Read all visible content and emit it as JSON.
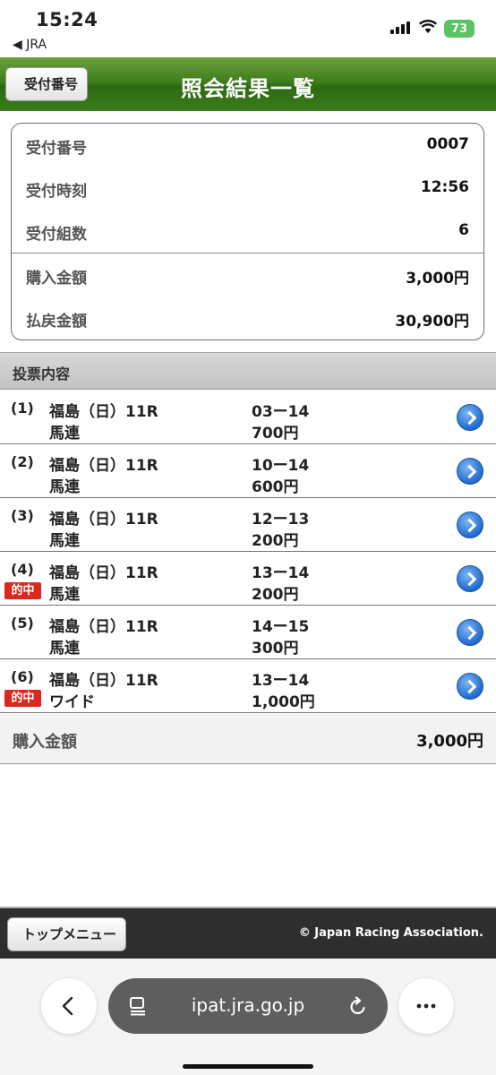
{
  "status_bar": {
    "time": "15:24",
    "back_app": "◀ JRA",
    "battery": "73"
  },
  "header": {
    "title": "照会結果一覧",
    "back_label": "受付番号"
  },
  "summary": [
    {
      "label": "受付番号",
      "value": "0007"
    },
    {
      "label": "受付時刻",
      "value": "12:56"
    },
    {
      "label": "受付組数",
      "value": "6"
    },
    {
      "label": "購入金額",
      "value": "3,000円"
    },
    {
      "label": "払戻金額",
      "value": "30,900円"
    }
  ],
  "section_title": "投票内容",
  "hit_label": "的中",
  "bets": [
    {
      "index": "(1)",
      "race": "福島（日）11R",
      "type": "馬連",
      "combo": "03ー14",
      "amount": "700円",
      "hit": false
    },
    {
      "index": "(2)",
      "race": "福島（日）11R",
      "type": "馬連",
      "combo": "10ー14",
      "amount": "600円",
      "hit": false
    },
    {
      "index": "(3)",
      "race": "福島（日）11R",
      "type": "馬連",
      "combo": "12ー13",
      "amount": "200円",
      "hit": false
    },
    {
      "index": "(4)",
      "race": "福島（日）11R",
      "type": "馬連",
      "combo": "13ー14",
      "amount": "200円",
      "hit": true
    },
    {
      "index": "(5)",
      "race": "福島（日）11R",
      "type": "馬連",
      "combo": "14ー15",
      "amount": "300円",
      "hit": false
    },
    {
      "index": "(6)",
      "race": "福島（日）11R",
      "type": "ワイド",
      "combo": "13ー14",
      "amount": "1,000円",
      "hit": true
    }
  ],
  "total": {
    "label": "購入金額",
    "value": "3,000円"
  },
  "footer": {
    "top_menu_label": "トップメニュー",
    "copyright": "© Japan Racing Association."
  },
  "browser": {
    "url": "ipat.jra.go.jp"
  },
  "colors": {
    "header_green": "#3f7e1d",
    "hit_red": "#d9281e",
    "arrow_blue": "#1f6ad0"
  }
}
